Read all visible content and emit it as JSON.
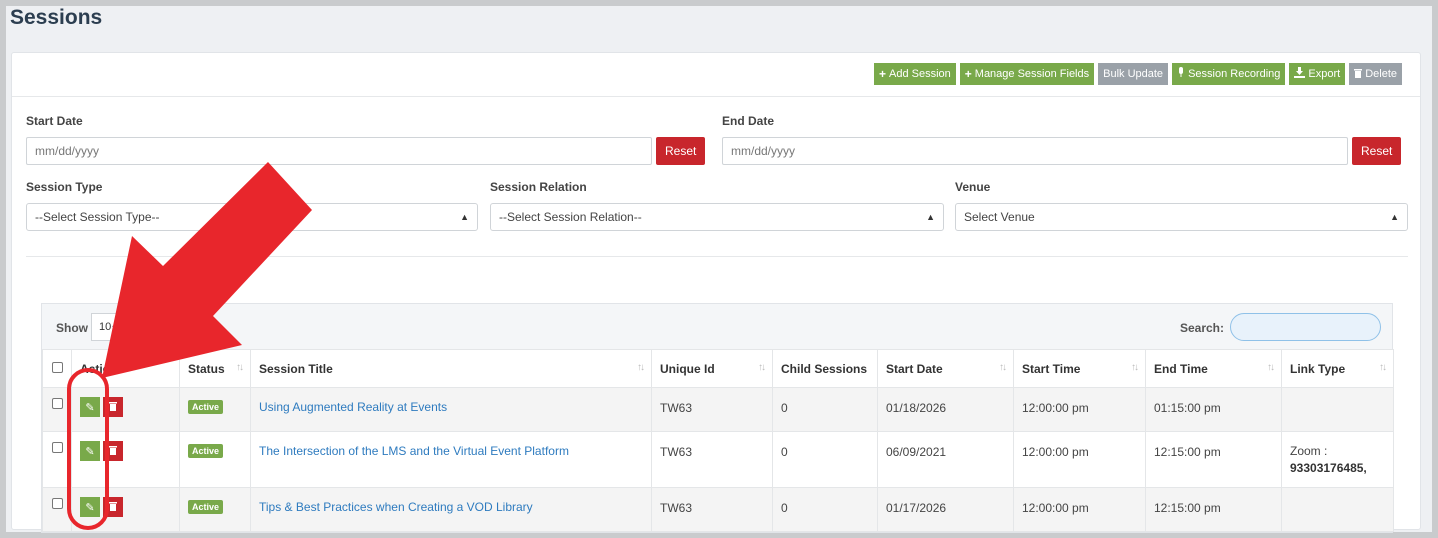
{
  "page": {
    "title": "Sessions"
  },
  "toolbar": {
    "add_session": "Add Session",
    "manage_fields": "Manage Session Fields",
    "bulk_update": "Bulk Update",
    "session_recording": "Session Recording",
    "export": "Export",
    "delete": "Delete"
  },
  "filters": {
    "start_date": {
      "label": "Start Date",
      "placeholder": "mm/dd/yyyy",
      "reset": "Reset"
    },
    "end_date": {
      "label": "End Date",
      "placeholder": "mm/dd/yyyy",
      "reset": "Reset"
    },
    "session_type": {
      "label": "Session Type",
      "value": "--Select Session Type--"
    },
    "session_relation": {
      "label": "Session Relation",
      "value": "--Select Session Relation--"
    },
    "venue": {
      "label": "Venue",
      "value": "Select Venue"
    }
  },
  "datatable": {
    "show_label": "Show",
    "page_length": "10",
    "search_label": "Search:",
    "columns": [
      "Action",
      "Status",
      "Session Title",
      "Unique Id",
      "Child Sessions",
      "Start Date",
      "Start Time",
      "End Time",
      "Link Type"
    ],
    "rows": [
      {
        "status": "Active",
        "title": "Using Augmented Reality at Events",
        "unique_id": "TW63",
        "child_sessions": "0",
        "start_date": "01/18/2026",
        "start_time": "12:00:00 pm",
        "end_time": "01:15:00 pm",
        "link_type_label": "",
        "link_type_value": ""
      },
      {
        "status": "Active",
        "title": "The Intersection of the LMS and the Virtual Event Platform",
        "unique_id": "TW63",
        "child_sessions": "0",
        "start_date": "06/09/2021",
        "start_time": "12:00:00 pm",
        "end_time": "12:15:00 pm",
        "link_type_label": "Zoom :",
        "link_type_value": "93303176485,"
      },
      {
        "status": "Active",
        "title": "Tips & Best Practices when Creating a VOD Library",
        "unique_id": "TW63",
        "child_sessions": "0",
        "start_date": "01/17/2026",
        "start_time": "12:00:00 pm",
        "end_time": "12:15:00 pm",
        "link_type_label": "",
        "link_type_value": ""
      }
    ]
  },
  "annotation": {
    "arrow_color": "#e8262c",
    "highlight_color": "#e8262c"
  },
  "icons": [
    "plus-icon",
    "microphone-icon",
    "download-icon",
    "trash-icon",
    "edit-icon",
    "sort-icon",
    "caret-icon"
  ]
}
